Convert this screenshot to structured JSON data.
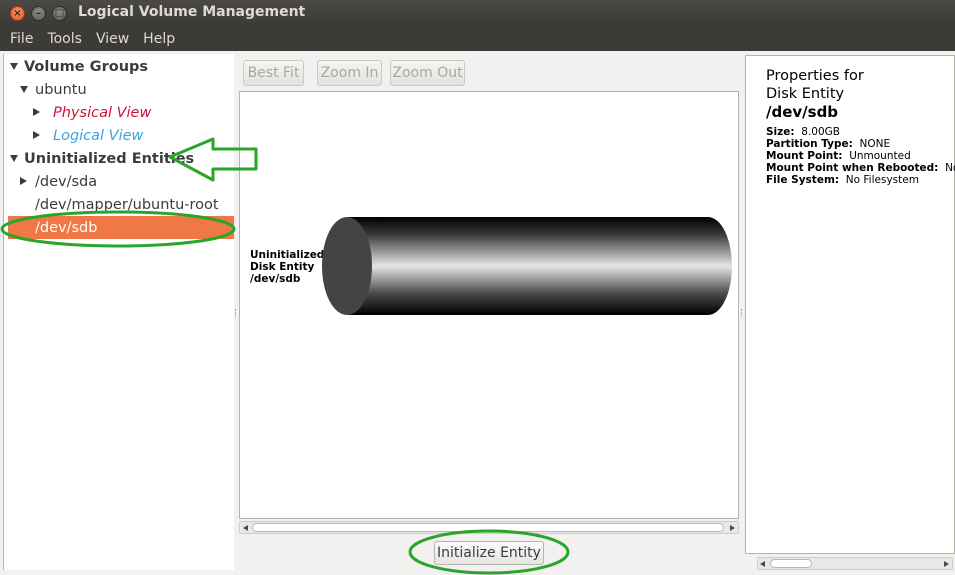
{
  "window": {
    "title": "Logical Volume Management",
    "close_glyph": "×",
    "min_glyph": "–",
    "max_glyph": "□"
  },
  "menu": [
    "File",
    "Tools",
    "View",
    "Help"
  ],
  "tree": {
    "volume_groups": "Volume Groups",
    "vg_name": "ubuntu",
    "physical_view": "Physical View",
    "logical_view": "Logical View",
    "uninitialized": "Uninitialized Entities",
    "entities": [
      "/dev/sda",
      "/dev/mapper/ubuntu-root",
      "/dev/sdb"
    ]
  },
  "toolbar": {
    "best_fit": "Best Fit",
    "zoom_in": "Zoom In",
    "zoom_out": "Zoom Out"
  },
  "canvas": {
    "label_line1": "Uninitialized",
    "label_line2": "Disk Entity",
    "label_line3": "/dev/sdb"
  },
  "actions": {
    "initialize": "Initialize Entity"
  },
  "properties": {
    "heading_line1": "Properties for",
    "heading_line2": "Disk Entity",
    "device": "/dev/sdb",
    "items": [
      {
        "key": "Size:",
        "value": "8.00GB"
      },
      {
        "key": "Partition Type:",
        "value": "NONE"
      },
      {
        "key": "Mount Point:",
        "value": "Unmounted"
      },
      {
        "key": "Mount Point when Rebooted:",
        "value": "None"
      },
      {
        "key": "File System:",
        "value": "No Filesystem"
      }
    ]
  },
  "colors": {
    "selection": "#f07746",
    "physical_view_text": "#d01437",
    "logical_view_text": "#3ba4e0",
    "annotation_green": "#2aa52a"
  }
}
